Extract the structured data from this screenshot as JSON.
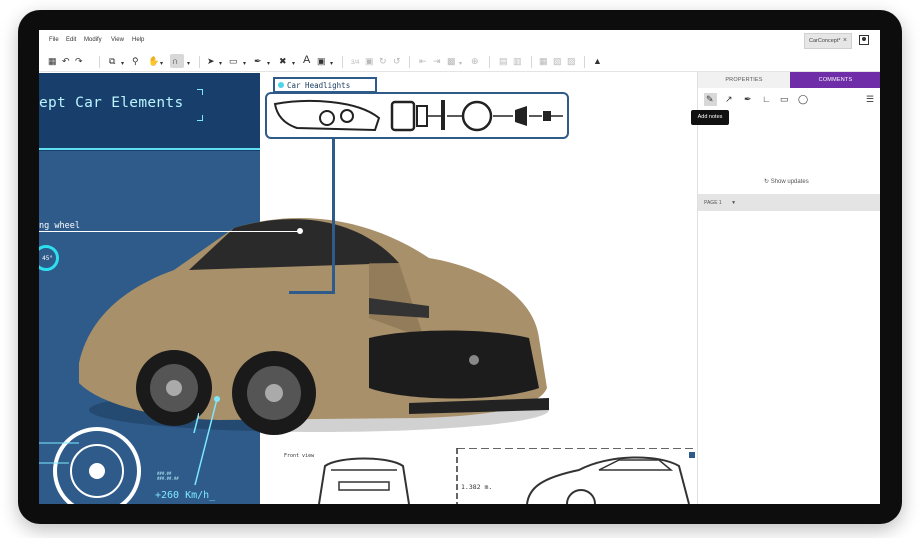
{
  "menu": {
    "items": [
      "File",
      "Edit",
      "Modify",
      "View",
      "Help"
    ]
  },
  "document_tab": {
    "label": "CarConcept*",
    "close": "×"
  },
  "toolbar": {
    "text_tool": "A",
    "light_label": "3/4"
  },
  "canvas": {
    "title": "ept Car Elements",
    "steering_label": "ng wheel",
    "gauge_value": "45°",
    "speed_label": "+260 Km/h_",
    "speed_small": "###.##\n###.##.##",
    "headlights_label": "Car Headlights",
    "front_view_label": "Front view",
    "measurement": "1.382 m."
  },
  "right_panel": {
    "tabs": {
      "properties": "PROPERTIES",
      "comments": "COMMENTS"
    },
    "tooltip": "Add notes",
    "show_updates": "Show updates",
    "page_selector": "PAGE 1"
  },
  "colors": {
    "accent_purple": "#6f2da8",
    "panel_blue": "#2e5b8a",
    "panel_dark_blue": "#183f6b",
    "cyan": "#5fe0f2",
    "car_body": "#a8906a"
  },
  "icons": {
    "toolbar": [
      "save-icon",
      "undo-icon",
      "redo-icon",
      "copy-icon",
      "zoom-icon",
      "pan-icon",
      "magnet-icon",
      "select-icon",
      "rectangle-icon",
      "pen-icon",
      "eraser-icon",
      "text-icon",
      "image-icon"
    ],
    "right_panel": [
      "add-notes-icon",
      "arrow-icon",
      "brush-icon",
      "line-icon",
      "rectangle-icon",
      "circle-icon",
      "filter-icon"
    ]
  }
}
